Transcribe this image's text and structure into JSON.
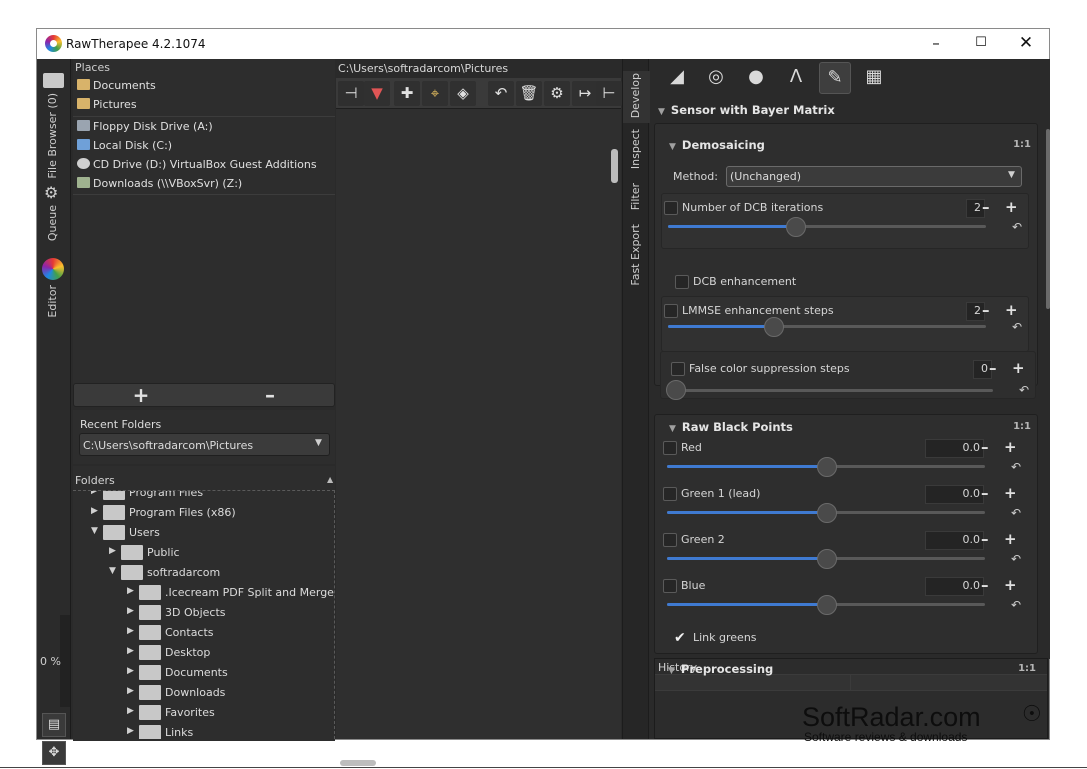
{
  "window": {
    "title": "RawTherapee 4.2.1074"
  },
  "left_tabs": {
    "file_browser": "File Browser (0)",
    "queue": "Queue",
    "editor": "Editor",
    "progress": "0 %"
  },
  "places": {
    "header": "Places",
    "items": [
      "Documents",
      "Pictures"
    ],
    "drives": [
      "Floppy Disk Drive (A:)",
      "Local Disk (C:)",
      "CD Drive (D:) VirtualBox Guest Additions",
      "Downloads (\\\\VBoxSvr) (Z:)"
    ]
  },
  "recent": {
    "label": "Recent Folders",
    "value": "C:\\Users\\softradarcom\\Pictures"
  },
  "folders": {
    "header": "Folders",
    "tree": [
      {
        "label": "Program Files",
        "depth": 1
      },
      {
        "label": "Program Files (x86)",
        "depth": 1
      },
      {
        "label": "Users",
        "depth": 1
      },
      {
        "label": "Public",
        "depth": 2
      },
      {
        "label": "softradarcom",
        "depth": 2
      },
      {
        "label": ".Icecream PDF Split and Merge",
        "depth": 3
      },
      {
        "label": "3D Objects",
        "depth": 3
      },
      {
        "label": "Contacts",
        "depth": 3
      },
      {
        "label": "Desktop",
        "depth": 3
      },
      {
        "label": "Documents",
        "depth": 3
      },
      {
        "label": "Downloads",
        "depth": 3
      },
      {
        "label": "Favorites",
        "depth": 3
      },
      {
        "label": "Links",
        "depth": 3
      }
    ]
  },
  "center": {
    "path": "C:\\Users\\softradarcom\\Pictures"
  },
  "right_tabs": [
    "Develop",
    "Inspect",
    "Filter",
    "Fast Export"
  ],
  "raw": {
    "section": "Sensor with Bayer Matrix",
    "demosaicing": {
      "title": "Demosaicing",
      "method_label": "Method:",
      "method_value": "(Unchanged)",
      "dcb_label": "Number of DCB iterations",
      "dcb_value": "2",
      "dcb_level": 0.4,
      "dcb_enh": "DCB enhancement",
      "lmmse_label": "LMMSE enhancement steps",
      "lmmse_value": "2",
      "lmmse_level": 0.33,
      "fcs_label": "False color suppression steps",
      "fcs_value": "0",
      "fcs_level": 0.0
    },
    "black": {
      "title": "Raw Black Points",
      "channels": [
        {
          "label": "Red",
          "value": "0.0",
          "level": 0.5
        },
        {
          "label": "Green 1 (lead)",
          "value": "0.0",
          "level": 0.5
        },
        {
          "label": "Green 2",
          "value": "0.0",
          "level": 0.5
        },
        {
          "label": "Blue",
          "value": "0.0",
          "level": 0.5
        }
      ],
      "link": "Link greens"
    },
    "preprocessing": "Preprocessing"
  },
  "history": {
    "header": "History"
  },
  "watermark": {
    "title": "SoftRadar.com",
    "subtitle": "Software reviews & downloads"
  },
  "colors": {
    "accent": "#3f7ad1",
    "bg": "#2a2a2a"
  }
}
